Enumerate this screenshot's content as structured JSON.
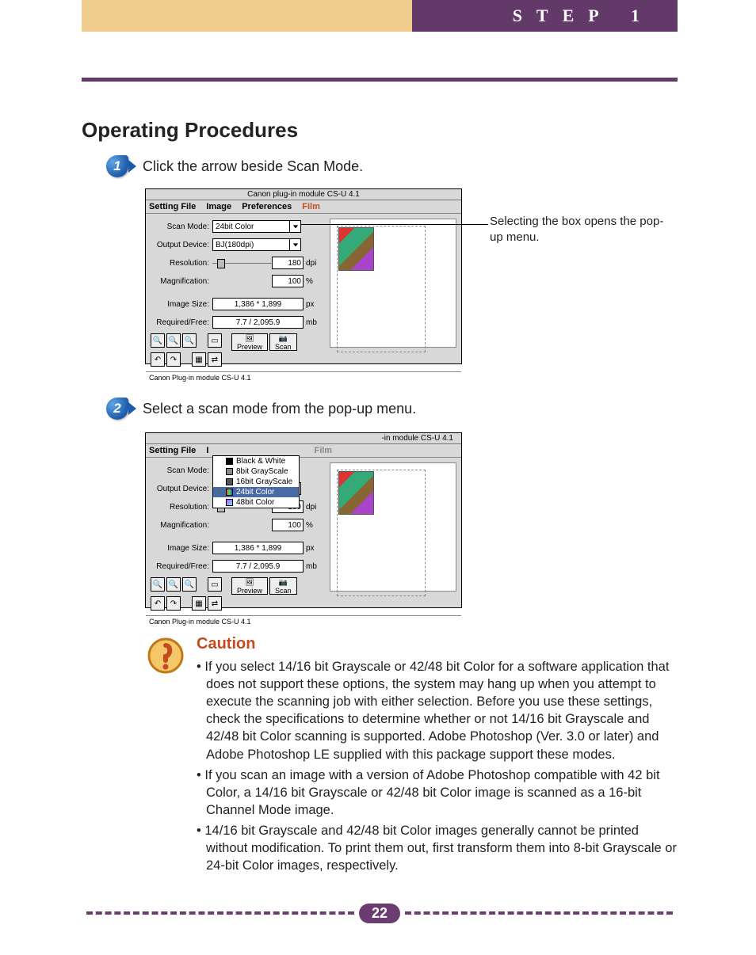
{
  "header": {
    "step_label": "STEP 1"
  },
  "heading": "Operating Procedures",
  "steps": {
    "s1": {
      "num": "1",
      "text": "Click the arrow beside Scan Mode."
    },
    "s2": {
      "num": "2",
      "text": "Select a scan mode from the pop-up menu."
    }
  },
  "callout": "Selecting the box opens the pop-up menu.",
  "screenshot": {
    "title": "Canon plug-in module CS-U 4.1",
    "menubar": {
      "m1": "Setting File",
      "m2": "Image",
      "m3": "Preferences",
      "m4": "Film"
    },
    "labels": {
      "scan_mode": "Scan Mode:",
      "output_device": "Output Device:",
      "resolution": "Resolution:",
      "magnification": "Magnification:",
      "image_size": "Image Size:",
      "required_free": "Required/Free:"
    },
    "values": {
      "scan_mode": "24bit Color",
      "output_device": "BJ(180dpi)",
      "resolution": "180",
      "resolution_unit": "dpi",
      "magnification": "100",
      "magnification_unit": "%",
      "image_size": "1,386 * 1,899",
      "image_size_unit": "px",
      "required_free": "7.7 / 2,095.9",
      "required_free_unit": "mb"
    },
    "buttons": {
      "preview": "Preview",
      "scan": "Scan"
    },
    "status": "Canon Plug-in module CS-U 4.1",
    "popup_title_suffix": "-in module CS-U 4.1",
    "popup": {
      "bw": "Black & White",
      "g8": "8bit GrayScale",
      "g16": "16bit GrayScale",
      "c24": "24bit Color",
      "c48": "48bit Color"
    }
  },
  "caution": {
    "title": "Caution",
    "b1": "• If you select 14/16 bit Grayscale or 42/48 bit Color for a software application that does not support these options, the system may hang up when you attempt to execute the scanning job with either selection. Before you use these settings, check the specifications to determine whether or not 14/16 bit Grayscale and 42/48 bit Color scanning is supported. Adobe Photoshop (Ver. 3.0 or later) and Adobe Photoshop LE supplied with this package support these modes.",
    "b2": "• If you scan an image with a version of Adobe Photoshop compatible with 42 bit Color, a 14/16 bit Grayscale or 42/48 bit Color image is scanned as a 16-bit Channel Mode image.",
    "b3": "• 14/16 bit Grayscale and 42/48 bit Color images generally cannot be printed without modification. To print them out, first transform them into 8-bit Grayscale or 24-bit Color images, respectively."
  },
  "page_number": "22"
}
